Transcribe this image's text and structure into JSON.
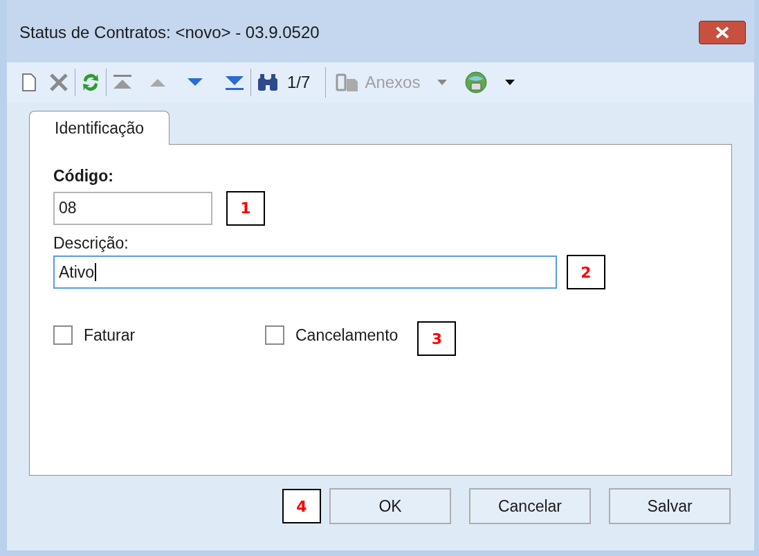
{
  "window": {
    "title": "Status de Contratos: <novo> - 03.9.0520"
  },
  "toolbar": {
    "record": "1/7",
    "attachments": {
      "label": "Anexos",
      "disabled": true
    }
  },
  "tabs": [
    {
      "label": "Identificação",
      "selected": true
    }
  ],
  "fields": [
    {
      "label": "Código:",
      "value": "08",
      "focused": false,
      "callout": "1"
    },
    {
      "label": "Descrição:",
      "value": "Ativo",
      "focused": true,
      "callout": "2"
    }
  ],
  "checkboxes": [
    {
      "label": "Faturar",
      "checked": false
    },
    {
      "label": "Cancelamento",
      "checked": false,
      "callout": "3"
    }
  ],
  "buttons_callout": "4",
  "buttons": [
    "OK",
    "Cancelar",
    "Salvar"
  ]
}
